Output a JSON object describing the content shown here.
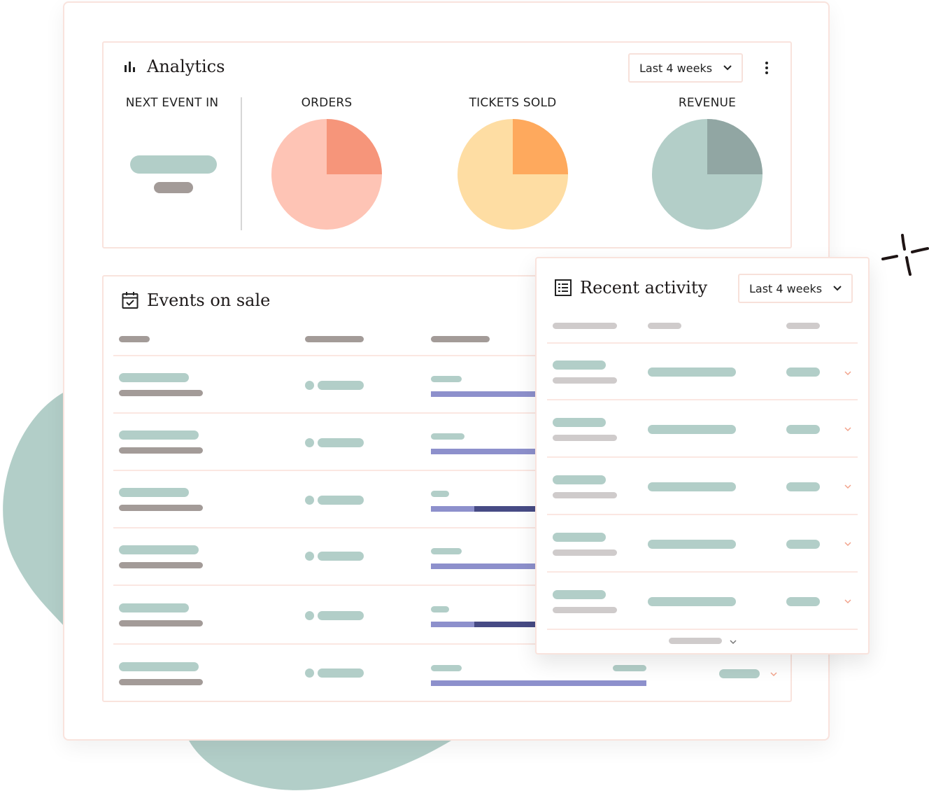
{
  "analytics": {
    "title": "Analytics",
    "title_icon": "bar-chart-icon",
    "range_dropdown": {
      "selected": "Last 4 weeks"
    },
    "metrics": [
      {
        "label": "NEXT EVENT IN"
      },
      {
        "label": "ORDERS",
        "pie_fraction": 0.25,
        "colors": {
          "main": "#fec4b5",
          "slice": "#f6957a"
        }
      },
      {
        "label": "TICKETS SOLD",
        "pie_fraction": 0.25,
        "colors": {
          "main": "#fedda3",
          "slice": "#fea95d"
        }
      },
      {
        "label": "REVENUE",
        "pie_fraction": 0.25,
        "colors": {
          "main": "#b3cec8",
          "slice": "#91a6a3"
        }
      }
    ]
  },
  "events_on_sale": {
    "title": "Events on sale",
    "title_icon": "calendar-check-icon",
    "rows_progress": [
      0.41,
      0.41,
      0.2,
      0.41,
      0.2,
      1.0
    ]
  },
  "recent_activity": {
    "title": "Recent activity",
    "title_icon": "list-icon",
    "range_dropdown": {
      "selected": "Last 4 weeks"
    }
  },
  "colors": {
    "teal": "#b2cec8",
    "taupe": "#a39b98",
    "purple": "#8d90cc",
    "navy": "#474b85",
    "border": "#f9e3dd"
  }
}
